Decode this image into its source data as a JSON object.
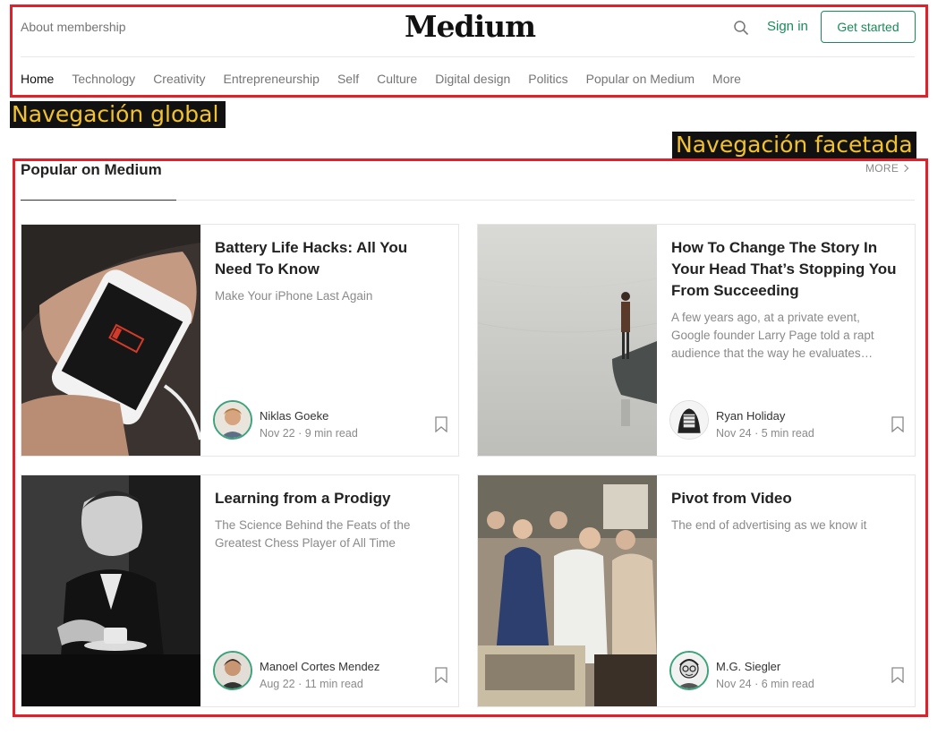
{
  "header": {
    "about": "About membership",
    "logo": "Medium",
    "signin": "Sign in",
    "get_started": "Get started"
  },
  "nav": {
    "items": [
      "Home",
      "Technology",
      "Creativity",
      "Entrepreneurship",
      "Self",
      "Culture",
      "Digital design",
      "Politics",
      "Popular on Medium",
      "More"
    ]
  },
  "annotations": {
    "global": "Navegación global",
    "faceted": "Navegación facetada"
  },
  "section": {
    "title": "Popular on Medium",
    "more": "MORE"
  },
  "cards": [
    {
      "title": "Battery Life Hacks: All You Need To Know",
      "subtitle": "Make Your iPhone Last Again",
      "author": "Niklas Goeke",
      "meta": "Nov 22 · 9 min read"
    },
    {
      "title": "How To Change The Story In Your Head That’s Stopping You From Succeeding",
      "subtitle": "A few years ago, at a private event, Google founder Larry Page told a rapt audience that the way he evaluates…",
      "author": "Ryan Holiday",
      "meta": "Nov 24 · 5 min read"
    },
    {
      "title": "Learning from a Prodigy",
      "subtitle": "The Science Behind the Feats of the Greatest Chess Player of All Time",
      "author": "Manoel Cortes Mendez",
      "meta": "Aug 22 · 11 min read"
    },
    {
      "title": "Pivot from Video",
      "subtitle": "The end of advertising as we know it",
      "author": "M.G. Siegler",
      "meta": "Nov 24 · 6 min read"
    }
  ],
  "colors": {
    "accent_green": "#1b8a5a",
    "annotation_red": "#e0202a",
    "annotation_label_bg": "#111111",
    "annotation_label_text": "#f2c12e"
  }
}
